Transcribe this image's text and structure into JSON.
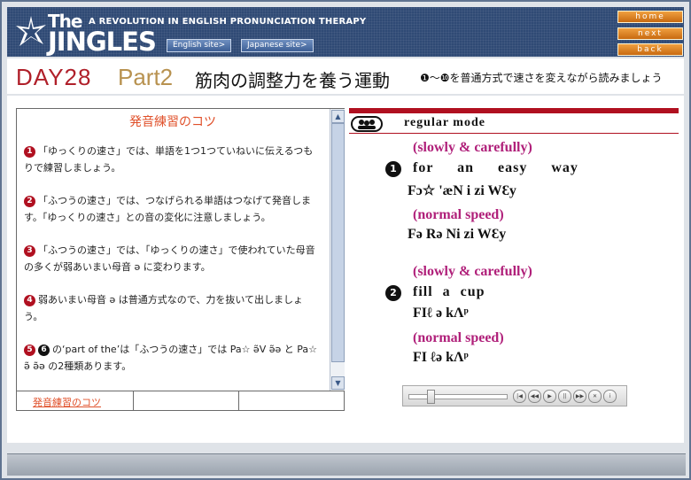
{
  "header": {
    "logo_the": "The",
    "logo_jingles": "JINGLES",
    "tagline": "A REVOLUTION IN ENGLISH PRONUNCIATION THERAPY",
    "english_site": "English site>",
    "japanese_site": "Japanese site>",
    "nav": {
      "home": "home",
      "next": "next",
      "back": "back"
    }
  },
  "title": {
    "day": "DAY28",
    "part": "Part2",
    "jp_title": "筋肉の調整力を養う運動",
    "instruction_start": "❶",
    "instruction_tilde": "～",
    "instruction_end": "❿",
    "instruction_text": "を普通方式で速さを変えながら読みましょう"
  },
  "tips": {
    "title": "発音練習のコツ",
    "items": [
      {
        "num": "1",
        "text": "「ゆっくりの速さ」では、単語を1つ1つていねいに伝えるつもりで練習しましょう。"
      },
      {
        "num": "2",
        "text": "「ふつうの速さ」では、つなげられる単語はつなげて発音します。「ゆっくりの速さ」との音の変化に注意しましょう。"
      },
      {
        "num": "3",
        "text": "「ふつうの速さ」では、「ゆっくりの速さ」で使われていた母音の多くが弱あいまい母音 ə に変わります。"
      },
      {
        "num": "4",
        "text": "弱あいまい母音 ə は普通方式なので、力を抜いて出しましょう。"
      },
      {
        "num": "5",
        "num2": "6",
        "text": "の‘part of the’は「ふつうの速さ」では Pa☆ ə̃V ə̃ə と Pa☆ ə̃ ə̃ə の2種類あります。"
      }
    ],
    "tab_label": "発音練習のコツ"
  },
  "practice": {
    "mode": "regular  mode",
    "items": [
      {
        "num": "1",
        "slow_label": "(slowly & carefully)",
        "words": "for an easy way",
        "slow_phon": "Fɔ☆  'æN  i zi  WƐy",
        "normal_label": "(normal speed)",
        "normal_phon": "Fə  Rə  Ni  zi  WƐy"
      },
      {
        "num": "2",
        "slow_label": "(slowly & carefully)",
        "words": "fill a cup",
        "slow_phon": "FIℓ  ə  kΛᵖ",
        "normal_label": "(normal speed)",
        "normal_phon": "FI  ℓə  kΛᵖ"
      }
    ]
  },
  "player": {
    "buttons": [
      "rewind-start",
      "prev",
      "play",
      "pause",
      "next",
      "stop",
      "info"
    ],
    "progress": 0.2
  },
  "colors": {
    "accent_red": "#b01020",
    "tip_orange": "#e0502a",
    "speed_magenta": "#b0207a",
    "nav_orange": "#e08a2a"
  }
}
